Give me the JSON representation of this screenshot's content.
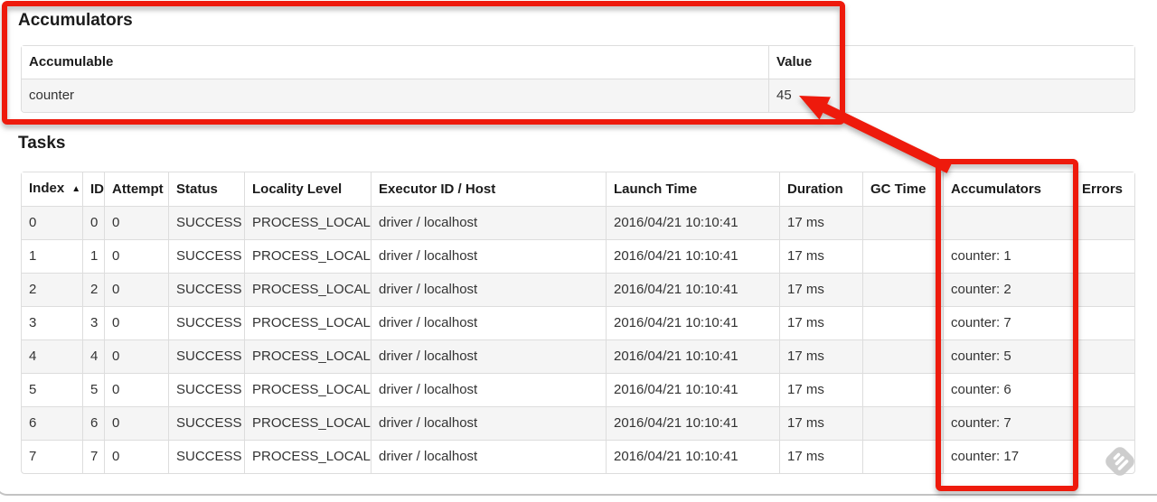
{
  "page": {
    "accumulators": {
      "heading": "Accumulators",
      "columns": [
        "Accumulable",
        "Value"
      ],
      "rows": [
        [
          "counter",
          "45"
        ]
      ]
    },
    "tasks": {
      "heading": "Tasks",
      "columns": [
        {
          "label": "Index",
          "sorted": true
        },
        {
          "label": "ID"
        },
        {
          "label": "Attempt"
        },
        {
          "label": "Status"
        },
        {
          "label": "Locality Level"
        },
        {
          "label": "Executor ID / Host"
        },
        {
          "label": "Launch Time"
        },
        {
          "label": "Duration"
        },
        {
          "label": "GC Time"
        },
        {
          "label": "Accumulators"
        },
        {
          "label": "Errors"
        }
      ],
      "sort_indicator": "▲",
      "rows": [
        [
          "0",
          "0",
          "0",
          "SUCCESS",
          "PROCESS_LOCAL",
          "driver / localhost",
          "2016/04/21 10:10:41",
          "17 ms",
          "",
          "",
          ""
        ],
        [
          "1",
          "1",
          "0",
          "SUCCESS",
          "PROCESS_LOCAL",
          "driver / localhost",
          "2016/04/21 10:10:41",
          "17 ms",
          "",
          "counter: 1",
          ""
        ],
        [
          "2",
          "2",
          "0",
          "SUCCESS",
          "PROCESS_LOCAL",
          "driver / localhost",
          "2016/04/21 10:10:41",
          "17 ms",
          "",
          "counter: 2",
          ""
        ],
        [
          "3",
          "3",
          "0",
          "SUCCESS",
          "PROCESS_LOCAL",
          "driver / localhost",
          "2016/04/21 10:10:41",
          "17 ms",
          "",
          "counter: 7",
          ""
        ],
        [
          "4",
          "4",
          "0",
          "SUCCESS",
          "PROCESS_LOCAL",
          "driver / localhost",
          "2016/04/21 10:10:41",
          "17 ms",
          "",
          "counter: 5",
          ""
        ],
        [
          "5",
          "5",
          "0",
          "SUCCESS",
          "PROCESS_LOCAL",
          "driver / localhost",
          "2016/04/21 10:10:41",
          "17 ms",
          "",
          "counter: 6",
          ""
        ],
        [
          "6",
          "6",
          "0",
          "SUCCESS",
          "PROCESS_LOCAL",
          "driver / localhost",
          "2016/04/21 10:10:41",
          "17 ms",
          "",
          "counter: 7",
          ""
        ],
        [
          "7",
          "7",
          "0",
          "SUCCESS",
          "PROCESS_LOCAL",
          "driver / localhost",
          "2016/04/21 10:10:41",
          "17 ms",
          "",
          "counter: 17",
          ""
        ]
      ]
    },
    "annotations": {
      "color": "#ee1a0c",
      "watermark_color": "#cdcdcd"
    }
  }
}
